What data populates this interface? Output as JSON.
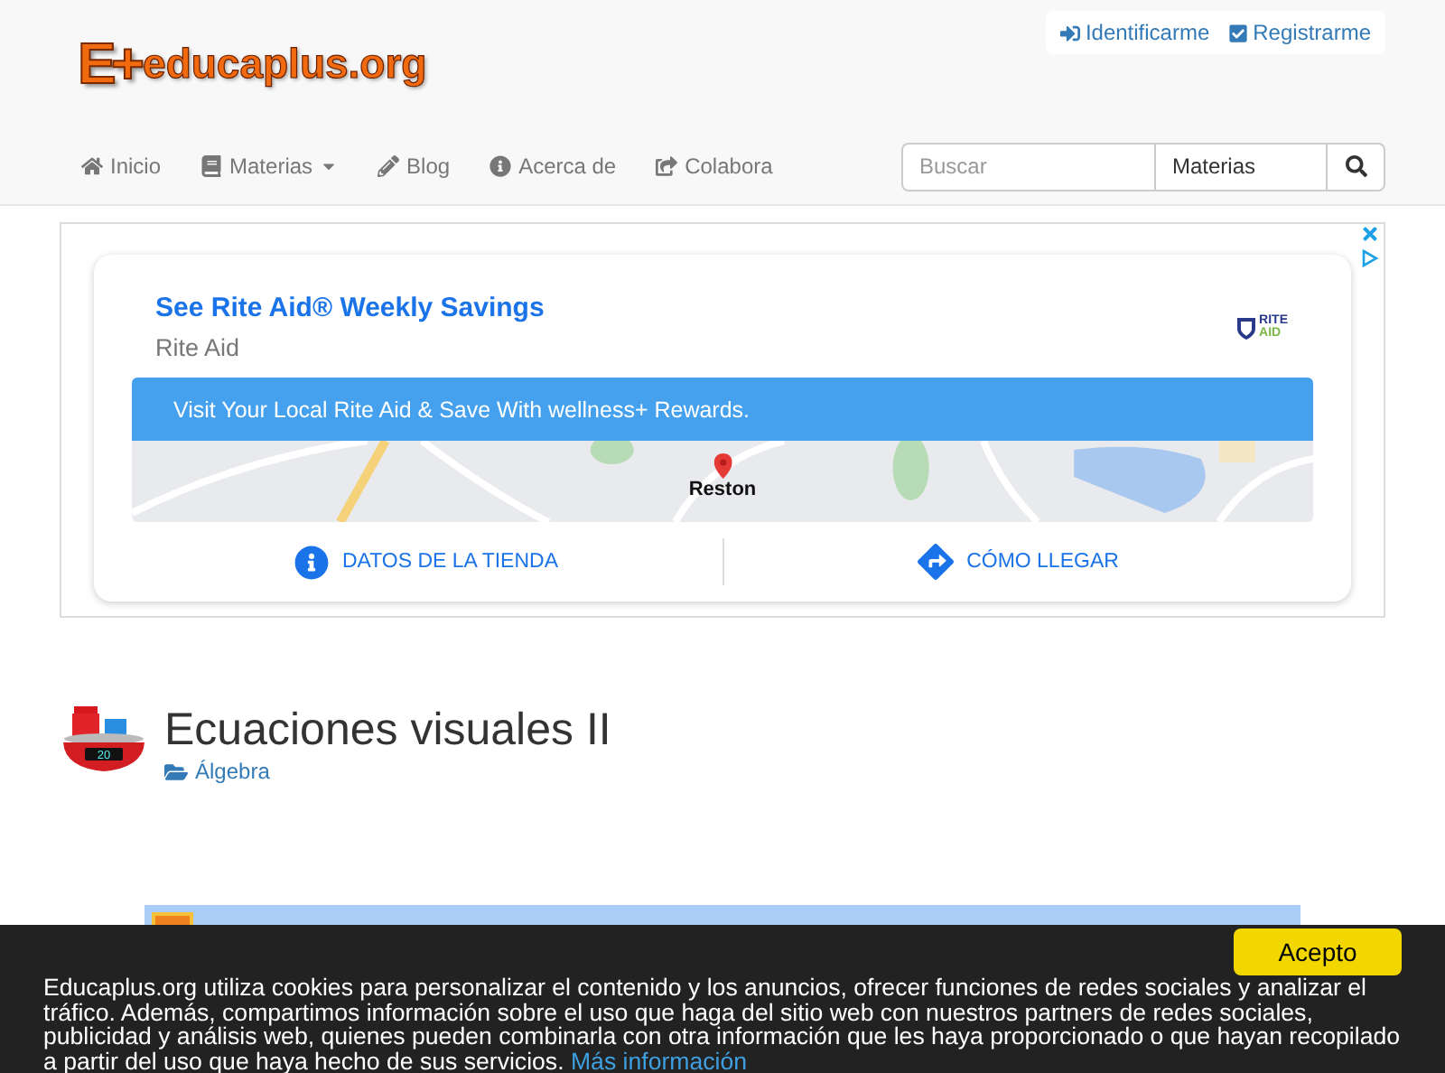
{
  "header": {
    "logo": {
      "mark": "E+",
      "name": "educaplus.org"
    },
    "account_links": [
      {
        "kind": "login",
        "label": "Identificarme"
      },
      {
        "kind": "register",
        "label": "Registrarme"
      }
    ]
  },
  "nav": {
    "items": [
      {
        "kind": "home",
        "label": "Inicio",
        "dropdown": false
      },
      {
        "kind": "book",
        "label": "Materias",
        "dropdown": true
      },
      {
        "kind": "pencil",
        "label": "Blog",
        "dropdown": false
      },
      {
        "kind": "info",
        "label": "Acerca de",
        "dropdown": false
      },
      {
        "kind": "share",
        "label": "Colabora",
        "dropdown": false
      }
    ],
    "search": {
      "placeholder": "Buscar",
      "category": "Materias"
    }
  },
  "ad": {
    "headline": "See Rite Aid® Weekly Savings",
    "advertiser": "Rite Aid",
    "logo_text": [
      "RITE",
      "AID"
    ],
    "banner": "Visit Your Local Rite Aid & Save With wellness+ Rewards.",
    "map_label": "Reston",
    "actions": [
      {
        "kind": "info",
        "label": "DATOS DE LA TIENDA"
      },
      {
        "kind": "directions",
        "label": "CÓMO LLEGAR"
      }
    ]
  },
  "page": {
    "title": "Ecuaciones visuales II",
    "category": "Álgebra",
    "scale_display": "20"
  },
  "cookie_bar": {
    "text": "Educaplus.org utiliza cookies para personalizar el contenido y los anuncios, ofrecer funciones de redes sociales y analizar el tráfico. Además, compartimos información sobre el uso que haga del sitio web con nuestros partners de redes sociales, publicidad y análisis web, quienes pueden combinarla con otra información que les haya proporcionado o que hayan recopilado a partir del uso que haya hecho de sus servicios.",
    "link": "Más información",
    "button": "Acepto"
  }
}
